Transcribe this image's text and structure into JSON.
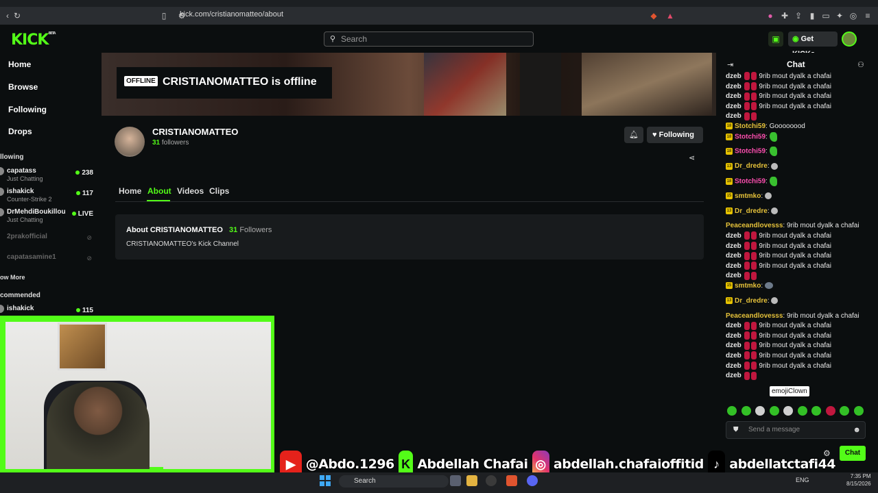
{
  "browser": {
    "url": "kick.com/cristianomatteo/about"
  },
  "header": {
    "logo": "KICK",
    "logo_beta": "BETA",
    "search_placeholder": "Search",
    "get_kicks_label": "Get KICKs"
  },
  "sidebar": {
    "nav": [
      "Home",
      "Browse",
      "Following",
      "Drops"
    ],
    "following_heading": "llowing",
    "channels": [
      {
        "name": "capatass",
        "sub": "Just Chatting",
        "count": "238"
      },
      {
        "name": "ishakick",
        "sub": "Counter-Strike 2",
        "count": "117"
      },
      {
        "name": "DrMehdiBoukillou",
        "sub": "Just Chatting",
        "count": "LIVE"
      },
      {
        "name": "2prakofficial",
        "sub": "",
        "count": ""
      },
      {
        "name": "capatasamine1",
        "sub": "",
        "count": ""
      }
    ],
    "show_more": "ow More",
    "recommended_heading": "commended",
    "recommended": [
      {
        "name": "ishakick",
        "count": "115"
      }
    ]
  },
  "channel": {
    "offline_badge": "OFFLINE",
    "offline_title": "CRISTIANOMATTEO is offline",
    "name": "CRISTIANOMATTEO",
    "followers_count": "31",
    "followers_label": "followers",
    "following_label": "Following",
    "tabs": [
      "Home",
      "About",
      "Videos",
      "Clips"
    ],
    "active_tab": "About",
    "about_title": "About CRISTIANOMATTEO",
    "about_followers_count": "31",
    "about_followers_label": "Followers",
    "about_description": "CRISTIANOMATTEO's Kick Channel"
  },
  "chat": {
    "title": "Chat",
    "lines": [
      {
        "user": "dzeb",
        "text": "9rib mout dyalk a chafai",
        "em": 2
      },
      {
        "user": "dzeb",
        "text": "9rib mout dyalk a chafai",
        "em": 2
      },
      {
        "user": "dzeb",
        "text": "9rib mout dyalk a chafai",
        "em": 2
      },
      {
        "user": "dzeb",
        "text": "9rib mout dyalk a chafai",
        "em": 2
      },
      {
        "user": "dzeb",
        "text": "",
        "em": 2
      },
      {
        "user": "Stotchi59",
        "color": "#e6c23a",
        "text": "Goooooood",
        "badge": "18"
      },
      {
        "user": "Stotchi59",
        "color": "#ff4fb0",
        "text": "",
        "badge": "18",
        "emoji": "green"
      },
      {
        "user": "Stotchi59",
        "color": "#ff4fb0",
        "text": "",
        "badge": "18",
        "emoji": "green"
      },
      {
        "user": "Dr_dredre",
        "color": "#e6c23a",
        "text": "",
        "badge": "13",
        "emoji": "gray"
      },
      {
        "user": "Stotchi59",
        "color": "#ff4fb0",
        "text": "",
        "badge": "18",
        "emoji": "green"
      },
      {
        "user": "smtmko",
        "color": "#e6c23a",
        "text": "",
        "badge": "15",
        "emoji": "gray"
      },
      {
        "user": "Dr_dredre",
        "color": "#e6c23a",
        "text": "",
        "badge": "13",
        "emoji": "gray"
      },
      {
        "user": "Peaceandlovesss",
        "color": "#e6c23a",
        "text": "9rib mout dyalk a chafai"
      },
      {
        "user": "dzeb",
        "text": "9rib mout dyalk a chafai",
        "em": 2
      },
      {
        "user": "dzeb",
        "text": "9rib mout dyalk a chafai",
        "em": 2
      },
      {
        "user": "dzeb",
        "text": "9rib mout dyalk a chafai",
        "em": 2
      },
      {
        "user": "dzeb",
        "text": "9rib mout dyalk a chafai",
        "em": 2
      },
      {
        "user": "dzeb",
        "text": "",
        "em": 2
      },
      {
        "user": "smtmko",
        "color": "#e6c23a",
        "text": "",
        "badge": "15",
        "emoji": "mouse"
      },
      {
        "user": "Dr_dredre",
        "color": "#e6c23a",
        "text": "",
        "badge": "13",
        "emoji": "gray"
      },
      {
        "user": "Peaceandlovesss",
        "color": "#e6c23a",
        "text": "9rib mout dyalk a chafai"
      },
      {
        "user": "dzeb",
        "text": "9rib mout dyalk a chafai",
        "em": 2
      },
      {
        "user": "dzeb",
        "text": "9rib mout dyalk a chafai",
        "em": 2
      },
      {
        "user": "dzeb",
        "text": "9rib mout dyalk a chafai",
        "em": 2
      },
      {
        "user": "dzeb",
        "text": "9rib mout dyalk a chafai",
        "em": 2
      },
      {
        "user": "dzeb",
        "text": "9rib mout dyalk a chafai",
        "em": 2
      },
      {
        "user": "dzeb",
        "text": "",
        "em": 2
      }
    ],
    "tooltip": "emojiClown",
    "input_placeholder": "Send a message",
    "send_label": "Chat"
  },
  "overlay": {
    "youtube": "@Abdo.1296",
    "kick": "Abdellah Chafai",
    "instagram": "abdellah.chafaioffitid",
    "tiktok": "abdellatctafi44"
  },
  "taskbar": {
    "search": "Search",
    "lang": "ENG",
    "time": "7:35 PM",
    "date": "8/15/2026"
  },
  "colors": {
    "accent": "#53fc18",
    "background": "#0b0e0f",
    "card": "#181b1d"
  }
}
